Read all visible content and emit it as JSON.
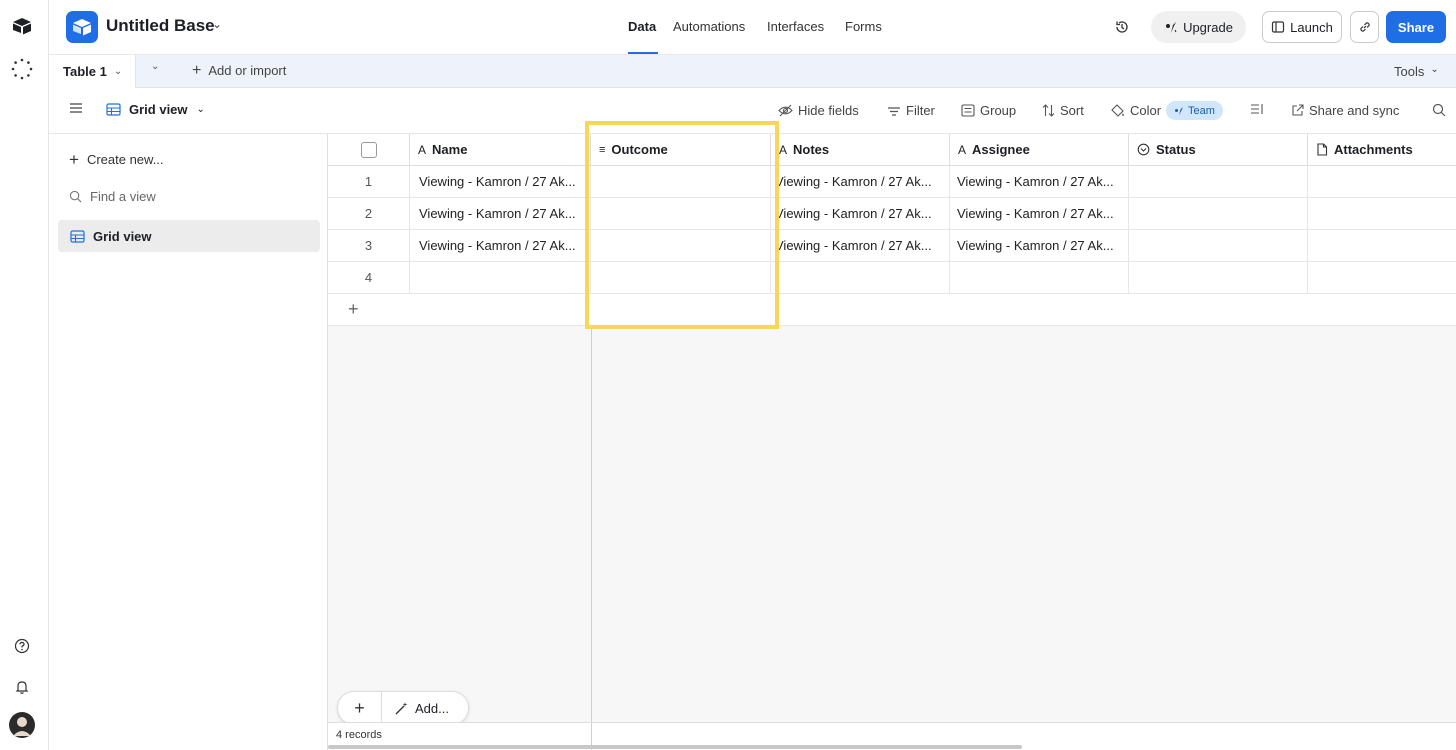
{
  "header": {
    "base_name": "Untitled Base",
    "nav_tabs": [
      "Data",
      "Automations",
      "Interfaces",
      "Forms"
    ],
    "active_tab": "Data",
    "upgrade_label": "Upgrade",
    "launch_label": "Launch",
    "share_label": "Share",
    "accent_color": "#1f6ee5"
  },
  "tabs_bar": {
    "table_tab": "Table 1",
    "add_or_import": "Add or import",
    "tools": "Tools"
  },
  "view_bar": {
    "view_name": "Grid view",
    "hide_fields": "Hide fields",
    "filter": "Filter",
    "group": "Group",
    "sort": "Sort",
    "color": "Color",
    "team_badge": "Team",
    "share_sync": "Share and sync"
  },
  "sidebar": {
    "create_new": "Create new...",
    "find_view": "Find a view",
    "views": [
      "Grid view"
    ]
  },
  "grid": {
    "columns": [
      {
        "label": "Name",
        "icon": "text-icon"
      },
      {
        "label": "Outcome",
        "icon": "long-text-icon"
      },
      {
        "label": "Notes",
        "icon": "text-icon"
      },
      {
        "label": "Assignee",
        "icon": "text-icon"
      },
      {
        "label": "Status",
        "icon": "status-icon"
      },
      {
        "label": "Attachments",
        "icon": "attachment-icon"
      }
    ],
    "rows": [
      {
        "num": "1",
        "name": "Viewing - Kamron / 27 Ak...",
        "outcome": "",
        "notes": "Viewing - Kamron / 27 Ak...",
        "assignee": "Viewing - Kamron / 27 Ak...",
        "status": "",
        "attachments": ""
      },
      {
        "num": "2",
        "name": "Viewing - Kamron / 27 Ak...",
        "outcome": "",
        "notes": "Viewing - Kamron / 27 Ak...",
        "assignee": "Viewing - Kamron / 27 Ak...",
        "status": "",
        "attachments": ""
      },
      {
        "num": "3",
        "name": "Viewing - Kamron / 27 Ak...",
        "outcome": "",
        "notes": "Viewing - Kamron / 27 Ak...",
        "assignee": "Viewing - Kamron / 27 Ak...",
        "status": "",
        "attachments": ""
      },
      {
        "num": "4",
        "name": "",
        "outcome": "",
        "notes": "",
        "assignee": "",
        "status": "",
        "attachments": ""
      }
    ],
    "add_label": "Add...",
    "record_count": "4 records"
  }
}
